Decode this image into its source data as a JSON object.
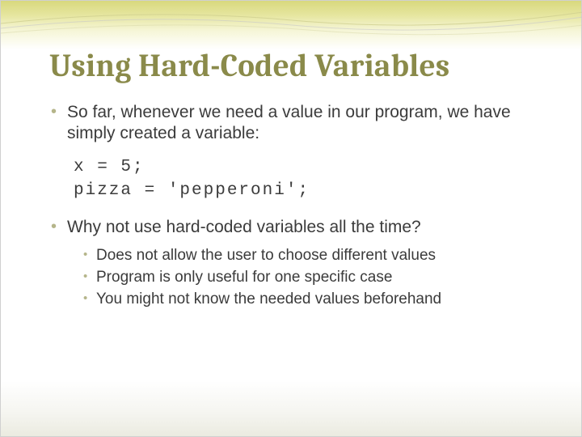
{
  "title": "Using Hard-Coded Variables",
  "bullets": {
    "intro": "So far, whenever we need a value in our program, we have simply created a variable:",
    "question": "Why not use hard-coded variables all the time?",
    "reasons": [
      "Does not allow the user to choose different values",
      "Program is only useful for one specific case",
      "You might not know the needed values beforehand"
    ]
  },
  "code": {
    "line1": "x = 5;",
    "line2": "pizza = 'pepperoni';"
  }
}
